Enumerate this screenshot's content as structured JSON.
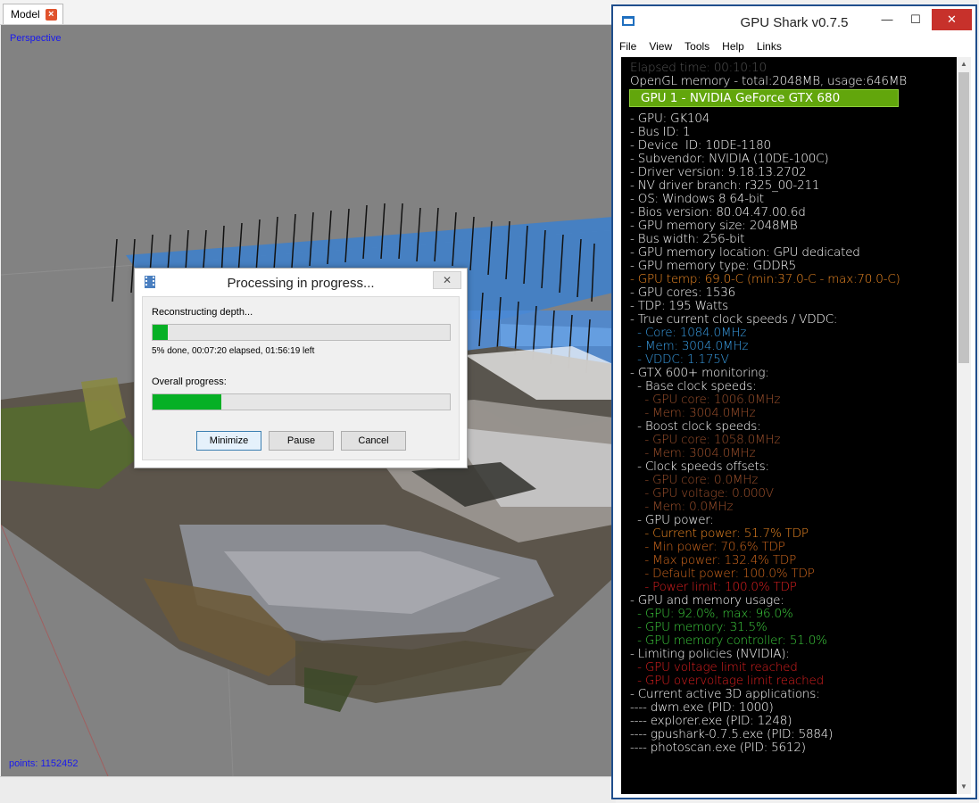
{
  "model_window": {
    "tab_label": "Model",
    "view_mode": "Perspective",
    "points_label": "points: 1152452"
  },
  "processing_dialog": {
    "title": "Processing in progress...",
    "close_glyph": "✕",
    "stage_label": "Reconstructing depth...",
    "stage_progress_percent": 5,
    "stage_status": "5% done, 00:07:20 elapsed, 01:56:19 left",
    "overall_label": "Overall progress:",
    "overall_progress_percent": 23,
    "buttons": {
      "minimize": "Minimize",
      "pause": "Pause",
      "cancel": "Cancel"
    }
  },
  "gpu_shark": {
    "title": "GPU Shark v0.7.5",
    "window_buttons": {
      "minimize": "—",
      "maximize": "☐",
      "close": "✕"
    },
    "menu": [
      "File",
      "View",
      "Tools",
      "Help",
      "Links"
    ],
    "lines": [
      {
        "text": "Elapsed time: 00:10:10",
        "color": "#555555"
      },
      {
        "text": "OpenGL memory - total:2048MB, usage:646MB",
        "color": "#ffffff"
      },
      {
        "text": "GPU 1 - NVIDIA GeForce GTX 680",
        "color": "#ffffff",
        "banner": true
      },
      {
        "text": "- GPU: GK104",
        "color": "#ffffff"
      },
      {
        "text": "- Bus ID: 1",
        "color": "#ffffff"
      },
      {
        "text": "- Device  ID: 10DE-1180",
        "color": "#ffffff"
      },
      {
        "text": "- Subvendor: NVIDIA (10DE-100C)",
        "color": "#ffffff"
      },
      {
        "text": "- Driver version: 9.18.13.2702",
        "color": "#ffffff"
      },
      {
        "text": "- NV driver branch: r325_00-211",
        "color": "#ffffff"
      },
      {
        "text": "- OS: Windows 8 64-bit",
        "color": "#ffffff"
      },
      {
        "text": "- Bios version: 80.04.47.00.6d",
        "color": "#ffffff"
      },
      {
        "text": "- GPU memory size: 2048MB",
        "color": "#ffffff"
      },
      {
        "text": "- Bus width: 256-bit",
        "color": "#ffffff"
      },
      {
        "text": "- GPU memory location: GPU dedicated",
        "color": "#ffffff"
      },
      {
        "text": "- GPU memory type: GDDR5",
        "color": "#ffffff"
      },
      {
        "text": "- GPU temp: 69.0-C (min:37.0-C - max:70.0-C)",
        "color": "#f08a24"
      },
      {
        "text": "- GPU cores: 1536",
        "color": "#ffffff"
      },
      {
        "text": "- TDP: 195 Watts",
        "color": "#ffffff"
      },
      {
        "text": "- True current clock speeds / VDDC:",
        "color": "#ffffff"
      },
      {
        "text": "  - Core: 1084.0MHz",
        "color": "#3aa0e8"
      },
      {
        "text": "  - Mem: 3004.0MHz",
        "color": "#3aa0e8"
      },
      {
        "text": "  - VDDC: 1.175V",
        "color": "#3aa0e8"
      },
      {
        "text": "- GTX 600+ monitoring:",
        "color": "#ffffff"
      },
      {
        "text": "  - Base clock speeds:",
        "color": "#ffffff"
      },
      {
        "text": "    - GPU core: 1006.0MHz",
        "color": "#a0522d"
      },
      {
        "text": "    - Mem: 3004.0MHz",
        "color": "#a0522d"
      },
      {
        "text": "  - Boost clock speeds:",
        "color": "#ffffff"
      },
      {
        "text": "    - GPU core: 1058.0MHz",
        "color": "#a0522d"
      },
      {
        "text": "    - Mem: 3004.0MHz",
        "color": "#a0522d"
      },
      {
        "text": "  - Clock speeds offsets:",
        "color": "#ffffff"
      },
      {
        "text": "    - GPU core: 0.0MHz",
        "color": "#a0522d"
      },
      {
        "text": "    - GPU voltage: 0.000V",
        "color": "#a0522d"
      },
      {
        "text": "    - Mem: 0.0MHz",
        "color": "#a0522d"
      },
      {
        "text": "  - GPU power:",
        "color": "#ffffff"
      },
      {
        "text": "    - Current power: 51.7% TDP",
        "color": "#f08a24"
      },
      {
        "text": "    - Min power: 70.6% TDP",
        "color": "#d2691e"
      },
      {
        "text": "    - Max power: 132.4% TDP",
        "color": "#d2691e"
      },
      {
        "text": "    - Default power: 100.0% TDP",
        "color": "#d2691e"
      },
      {
        "text": "    - Power limit: 100.0% TDP",
        "color": "#e02020"
      },
      {
        "text": "- GPU and memory usage:",
        "color": "#ffffff"
      },
      {
        "text": "  - GPU: 92.0%, max: 96.0%",
        "color": "#3ecf3e"
      },
      {
        "text": "  - GPU memory: 31.5%",
        "color": "#3ecf3e"
      },
      {
        "text": "  - GPU memory controller: 51.0%",
        "color": "#3ecf3e"
      },
      {
        "text": "- Limiting policies (NVIDIA):",
        "color": "#ffffff"
      },
      {
        "text": "  - GPU voltage limit reached",
        "color": "#e02020"
      },
      {
        "text": "  - GPU overvoltage limit reached",
        "color": "#e02020"
      },
      {
        "text": "- Current active 3D applications:",
        "color": "#ffffff"
      },
      {
        "text": "---- dwm.exe (PID: 1000)",
        "color": "#ffffff"
      },
      {
        "text": "---- explorer.exe (PID: 1248)",
        "color": "#ffffff"
      },
      {
        "text": "---- gpushark-0.7.5.exe (PID: 5884)",
        "color": "#ffffff"
      },
      {
        "text": "---- photoscan.exe (PID: 5612)",
        "color": "#ffffff"
      }
    ]
  }
}
